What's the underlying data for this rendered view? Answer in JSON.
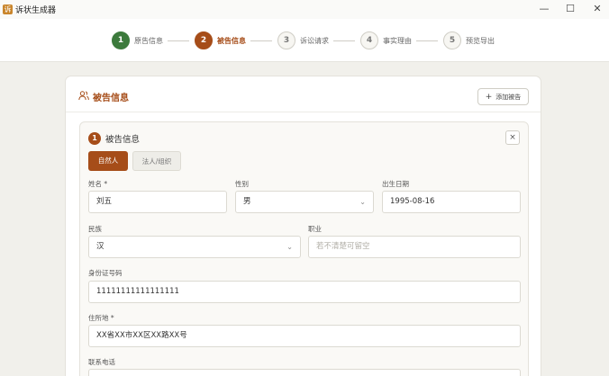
{
  "app": {
    "title": "诉状生成器"
  },
  "window": {
    "min": "—",
    "max": "☐",
    "close": "✕"
  },
  "steps": [
    {
      "num": "1",
      "label": "原告信息",
      "state": "done"
    },
    {
      "num": "2",
      "label": "被告信息",
      "state": "active"
    },
    {
      "num": "3",
      "label": "诉讼请求",
      "state": "todo"
    },
    {
      "num": "4",
      "label": "事实理由",
      "state": "todo"
    },
    {
      "num": "5",
      "label": "预览导出",
      "state": "todo"
    }
  ],
  "card": {
    "title": "被告信息",
    "add_label": "添加被告",
    "add_icon": "+"
  },
  "defendant": {
    "num": "1",
    "title": "被告信息",
    "close": "×",
    "types": [
      "自然人",
      "法人/组织"
    ],
    "fields": {
      "name_label": "姓名 *",
      "name_value": "刘五",
      "gender_label": "性别",
      "gender_value": "男",
      "birth_label": "出生日期",
      "birth_value": "1995-08-16",
      "ethnic_label": "民族",
      "ethnic_value": "汉",
      "job_label": "职业",
      "job_placeholder": "若不清楚可留空",
      "id_label": "身份证号码",
      "id_value": "11111111111111111",
      "address_label": "住所地 *",
      "address_value": "XX省XX市XX区XX路XX号",
      "phone_label": "联系电话"
    }
  },
  "colors": {
    "accent": "#a64d19",
    "done": "#3c7a3c"
  },
  "icons": {
    "chevron": "⌄"
  }
}
